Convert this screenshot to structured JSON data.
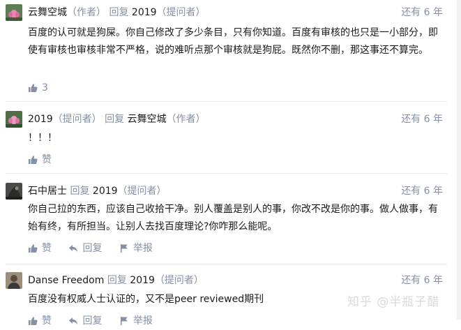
{
  "comments": [
    {
      "author": "云舞空城",
      "author_tag": "（作者）",
      "reply_word": "回复",
      "reply_to": "2019",
      "reply_to_tag": "（提问者）",
      "time": "还有 6 年",
      "content": "百度的认可就是狗屎。你自己修改了多少条目，只有你知道。百度有审核的也只是一小部分，即使有审核也审核非常不严格，说的难听点那个审核就是狗屁。既然你不删，那这事还不算完。",
      "likes": "3"
    },
    {
      "author": "2019",
      "author_tag": "（提问者）",
      "reply_word": "回复",
      "reply_to": "云舞空城",
      "reply_to_tag": "（作者）",
      "time": "还有 6 年",
      "content": "！！！",
      "like_label": "赞"
    },
    {
      "author": "石中居士",
      "reply_word": "回复",
      "reply_to": "2019",
      "reply_to_tag": "（提问者）",
      "time": "还有 6 年",
      "content": "你自己拉的东西，应该自己收拾干净。别人覆盖是别人的事，你改不改是你的事。做人做事，有始有终，有所担当。让别人去找百度理论?你咋那么能呢。",
      "like_label": "赞",
      "reply_label": "回复",
      "report_label": "举报"
    },
    {
      "author": "Danse Freedom",
      "reply_word": "回复",
      "reply_to": "2019",
      "reply_to_tag": "（提问者）",
      "time": "还有 6 年",
      "content": "百度没有权威人士认证的，又不是peer reviewed期刊",
      "like_label": "赞",
      "reply_label": "回复",
      "report_label": "举报"
    }
  ],
  "watermark": "知乎 @半瓶子醋",
  "colors": {
    "meta": "#8590a6",
    "text": "#1a1a1a",
    "divider": "#ebebeb"
  }
}
